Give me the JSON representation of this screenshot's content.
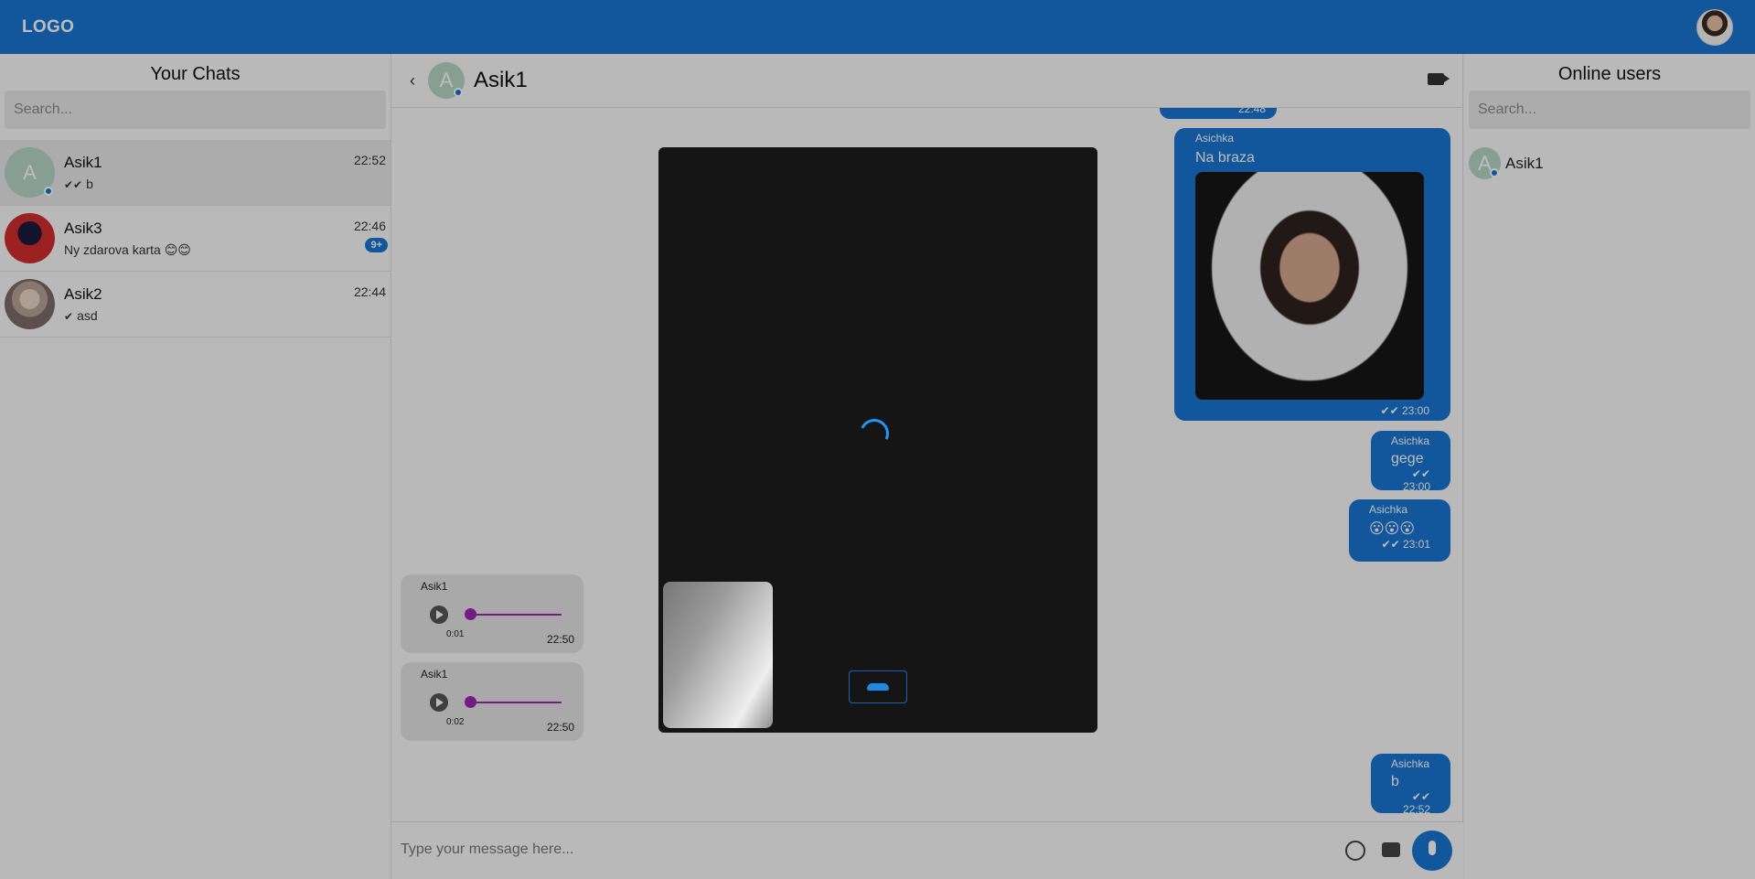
{
  "header": {
    "logo": "LOGO"
  },
  "left": {
    "title": "Your Chats",
    "search_placeholder": "Search...",
    "chats": [
      {
        "name": "Asik1",
        "time": "22:52",
        "avatar_letter": "A",
        "check": "✔✔",
        "last": "b",
        "badge": ""
      },
      {
        "name": "Asik3",
        "time": "22:46",
        "avatar_letter": "",
        "check": "",
        "last": "Ny zdarova karta 😊😊",
        "badge": "9+"
      },
      {
        "name": "Asik2",
        "time": "22:44",
        "avatar_letter": "",
        "check": "✔",
        "last": "asd",
        "badge": ""
      }
    ]
  },
  "chat": {
    "name": "Asik1",
    "avatar_letter": "A",
    "partial_time": "22:48",
    "outgoing": [
      {
        "sender": "Asichka",
        "text": "Na braza",
        "time": "✔✔ 23:00"
      },
      {
        "sender": "Asichka",
        "text": "gege",
        "time": "✔✔ 23:00"
      },
      {
        "sender": "Asichka",
        "text": "😮😮😮",
        "time": "✔✔ 23:01"
      },
      {
        "sender": "Asichka",
        "text": "b",
        "time": "✔✔ 22:52"
      }
    ],
    "incoming": [
      {
        "sender": "Asik1",
        "duration": "0:01",
        "time": "22:50"
      },
      {
        "sender": "Asik1",
        "duration": "0:02",
        "time": "22:50"
      }
    ],
    "composer_placeholder": "Type your message here..."
  },
  "right": {
    "title": "Online users",
    "search_placeholder": "Search...",
    "users": [
      {
        "name": "Asik1",
        "avatar_letter": "A"
      }
    ]
  },
  "colors": {
    "brand": "#1976d2",
    "audio_track": "#9c27b0"
  }
}
